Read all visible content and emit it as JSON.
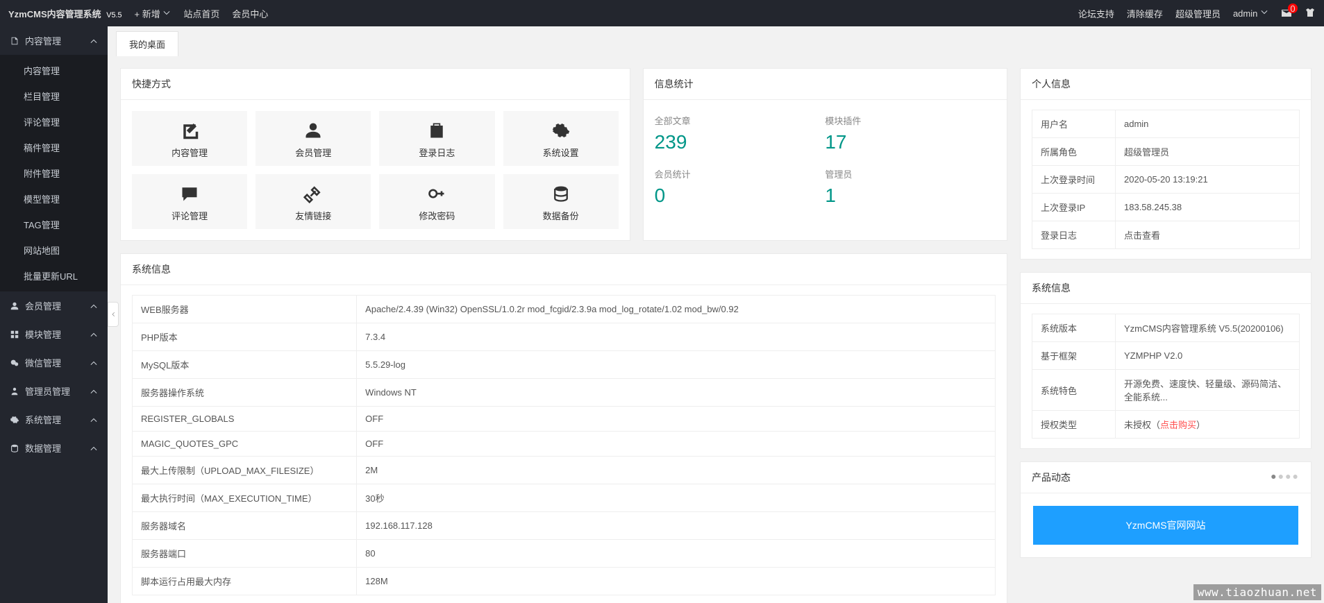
{
  "header": {
    "logo_name": "YzmCMS内容管理系统",
    "logo_version": "V5.5",
    "add_new": "+ 新增",
    "site_home": "站点首页",
    "member_center": "会员中心",
    "forum_support": "论坛支持",
    "clear_cache": "清除缓存",
    "role_label": "超级管理员",
    "user_label": "admin",
    "mail_count": "0"
  },
  "sidebar": {
    "sections": [
      {
        "label": "内容管理",
        "open": true,
        "items": [
          "内容管理",
          "栏目管理",
          "评论管理",
          "稿件管理",
          "附件管理",
          "模型管理",
          "TAG管理",
          "网站地图",
          "批量更新URL"
        ]
      },
      {
        "label": "会员管理",
        "open": false,
        "items": []
      },
      {
        "label": "模块管理",
        "open": false,
        "items": []
      },
      {
        "label": "微信管理",
        "open": false,
        "items": []
      },
      {
        "label": "管理员管理",
        "open": false,
        "items": []
      },
      {
        "label": "系统管理",
        "open": false,
        "items": []
      },
      {
        "label": "数据管理",
        "open": false,
        "items": []
      }
    ]
  },
  "tabs": {
    "active": "我的桌面"
  },
  "shortcuts": {
    "title": "快捷方式",
    "items": [
      {
        "label": "内容管理",
        "icon": "edit"
      },
      {
        "label": "会员管理",
        "icon": "user"
      },
      {
        "label": "登录日志",
        "icon": "clipboard"
      },
      {
        "label": "系统设置",
        "icon": "gear"
      },
      {
        "label": "评论管理",
        "icon": "comment"
      },
      {
        "label": "友情链接",
        "icon": "link"
      },
      {
        "label": "修改密码",
        "icon": "key"
      },
      {
        "label": "数据备份",
        "icon": "database"
      }
    ]
  },
  "stats": {
    "title": "信息统计",
    "items": [
      {
        "label": "全部文章",
        "value": "239"
      },
      {
        "label": "模块插件",
        "value": "17"
      },
      {
        "label": "会员统计",
        "value": "0"
      },
      {
        "label": "管理员",
        "value": "1"
      }
    ]
  },
  "personal": {
    "title": "个人信息",
    "rows": [
      {
        "k": "用户名",
        "v": "admin"
      },
      {
        "k": "所属角色",
        "v": "超级管理员"
      },
      {
        "k": "上次登录时间",
        "v": "2020-05-20 13:19:21"
      },
      {
        "k": "上次登录IP",
        "v": "183.58.245.38"
      },
      {
        "k": "登录日志",
        "v": "点击查看",
        "link": true
      }
    ]
  },
  "sysinfo": {
    "title": "系统信息",
    "rows": [
      {
        "k": "WEB服务器",
        "v": "Apache/2.4.39 (Win32) OpenSSL/1.0.2r mod_fcgid/2.3.9a mod_log_rotate/1.02 mod_bw/0.92"
      },
      {
        "k": "PHP版本",
        "v": "7.3.4"
      },
      {
        "k": "MySQL版本",
        "v": "5.5.29-log"
      },
      {
        "k": "服务器操作系统",
        "v": "Windows NT"
      },
      {
        "k": "REGISTER_GLOBALS",
        "v": "OFF"
      },
      {
        "k": "MAGIC_QUOTES_GPC",
        "v": "OFF"
      },
      {
        "k": "最大上传限制（UPLOAD_MAX_FILESIZE）",
        "v": "2M"
      },
      {
        "k": "最大执行时间（MAX_EXECUTION_TIME）",
        "v": "30秒"
      },
      {
        "k": "服务器域名",
        "v": "192.168.117.128"
      },
      {
        "k": "服务器端口",
        "v": "80"
      },
      {
        "k": "脚本运行占用最大内存",
        "v": "128M"
      }
    ]
  },
  "sysmeta": {
    "title": "系统信息",
    "rows": [
      {
        "k": "系统版本",
        "v": "YzmCMS内容管理系统 V5.5(20200106)"
      },
      {
        "k": "基于框架",
        "v": "YZMPHP V2.0"
      },
      {
        "k": "系统特色",
        "v": "开源免费、速度快、轻量级、源码简洁、全能系统..."
      },
      {
        "k": "授权类型",
        "prefix": "未授权（",
        "red": "点击购买",
        "suffix": "）"
      }
    ]
  },
  "news": {
    "title": "产品动态",
    "link_label": "YzmCMS官网网站"
  },
  "watermark": "www.tiaozhuan.net"
}
